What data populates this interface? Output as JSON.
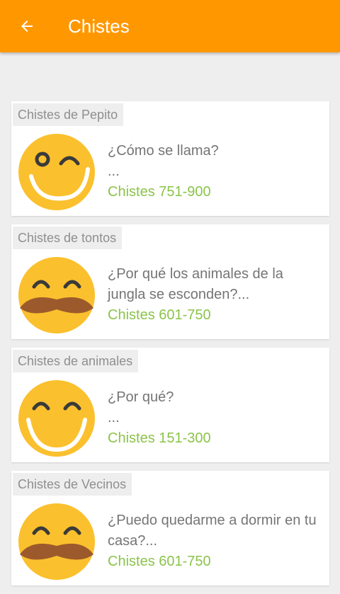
{
  "appbar": {
    "title": "Chistes",
    "background": "#ff9800",
    "back_icon": "arrow-back-icon"
  },
  "cards": [
    {
      "tag": "Chistes de Pepito",
      "line1": "¿Cómo se llama?",
      "line2": "...",
      "category": "Chistes 751-900",
      "icon": "winking-smiley-icon"
    },
    {
      "tag": "Chistes de tontos",
      "line1": "¿Por qué los animales de la",
      "line2": "jungla se esconden?...",
      "category": "Chistes 601-750",
      "icon": "mustache-smiley-icon"
    },
    {
      "tag": "Chistes de animales",
      "line1": "¿Por qué?",
      "line2": "...",
      "category": "Chistes 151-300",
      "icon": "smiley-icon"
    },
    {
      "tag": "Chistes de Vecinos",
      "line1": "¿Puedo quedarme a dormir en tu",
      "line2": "casa?...",
      "category": "Chistes 601-750",
      "icon": "mustache-smiley-icon"
    }
  ],
  "colors": {
    "accent": "#ff9800",
    "category_text": "#8bc34a",
    "face": "#fbc02d",
    "mustache": "#9c5a2c"
  }
}
